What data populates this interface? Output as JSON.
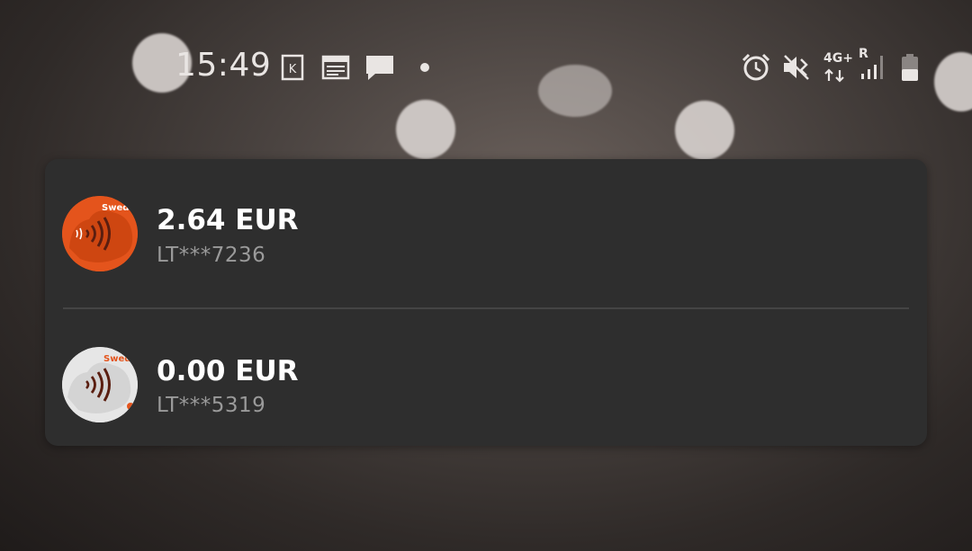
{
  "status_bar": {
    "time": "15:49",
    "icons": [
      "k-app-icon",
      "news-icon",
      "chat-icon",
      "dot-icon",
      "alarm-icon",
      "vibrate-icon",
      "4g-data-icon",
      "signal-icon",
      "battery-icon"
    ],
    "network_label": "4G+",
    "roaming_label": "R"
  },
  "accounts": [
    {
      "amount": "2.64 EUR",
      "account": "LT***7236",
      "card_color": "#e4541c",
      "brand": "Swedb"
    },
    {
      "amount": "0.00 EUR",
      "account": "LT***5319",
      "card_color": "#e6e6e6",
      "brand": "Swedb"
    }
  ],
  "colors": {
    "card_bg": "#2e2e2e",
    "amount_text": "#ffffff",
    "account_text": "#9a9a9a"
  }
}
